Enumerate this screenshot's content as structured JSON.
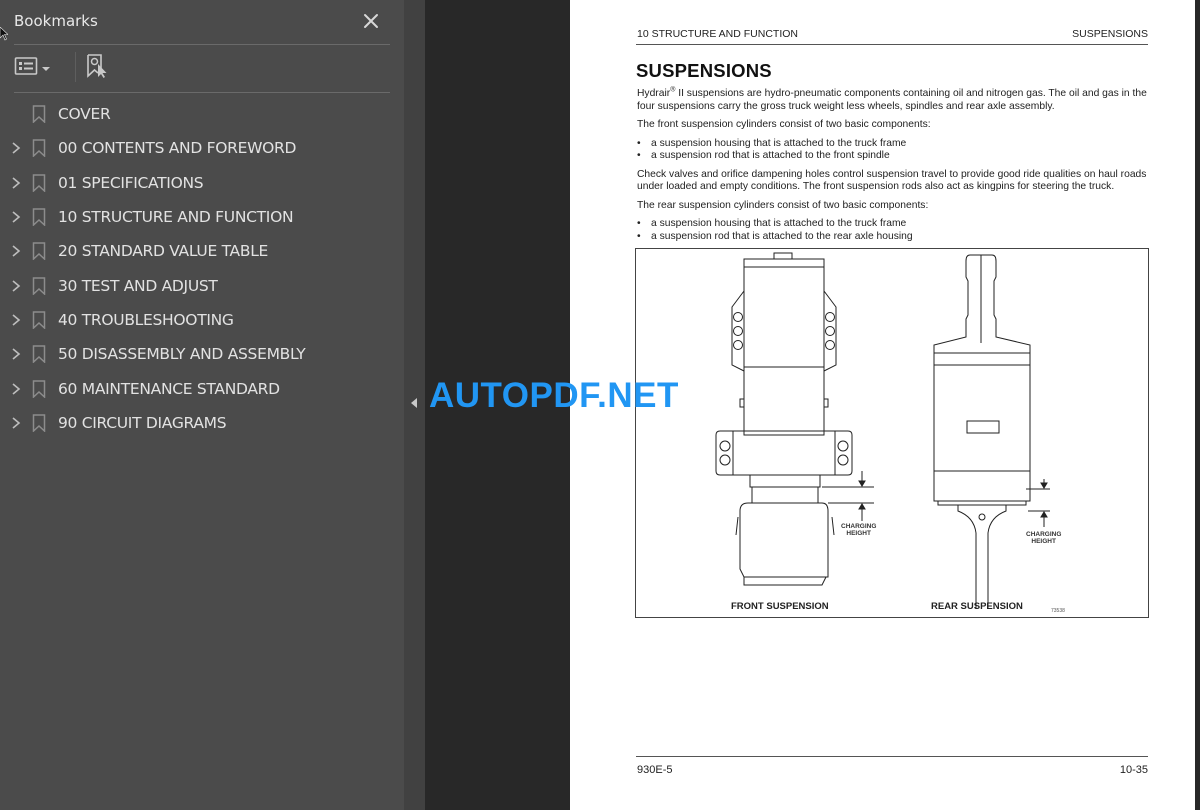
{
  "bookmarks_panel": {
    "title": "Bookmarks",
    "close_icon": "close-icon",
    "toolbar": {
      "options_icon": "list-options-icon",
      "dropdown_icon": "caret-down-icon",
      "find_bookmark_icon": "bookmark-find-icon"
    },
    "items": [
      {
        "label": "COVER",
        "expandable": false
      },
      {
        "label": "00 CONTENTS AND FOREWORD",
        "expandable": true
      },
      {
        "label": "01 SPECIFICATIONS",
        "expandable": true
      },
      {
        "label": "10 STRUCTURE AND FUNCTION",
        "expandable": true
      },
      {
        "label": "20 STANDARD VALUE TABLE",
        "expandable": true
      },
      {
        "label": "30 TEST AND ADJUST",
        "expandable": true
      },
      {
        "label": "40 TROUBLESHOOTING",
        "expandable": true
      },
      {
        "label": "50 DISASSEMBLY AND ASSEMBLY",
        "expandable": true
      },
      {
        "label": "60 MAINTENANCE STANDARD",
        "expandable": true
      },
      {
        "label": "90 CIRCUIT DIAGRAMS",
        "expandable": true
      }
    ]
  },
  "watermark": "AUTOPDF.NET",
  "page": {
    "header_left": "10 STRUCTURE AND FUNCTION",
    "header_right": "SUSPENSIONS",
    "title": "SUSPENSIONS",
    "intro_brand": "Hydrair",
    "intro_reg": "®",
    "intro_rest": " II suspensions are hydro-pneumatic components containing oil and nitrogen gas. The oil and gas in the four suspensions carry the gross truck weight less wheels, spindles and rear axle assembly.",
    "front_intro": "The front suspension cylinders consist of two basic components:",
    "front_bullets": [
      "a suspension housing that is attached to the truck frame",
      "a suspension rod that is attached to the front spindle"
    ],
    "check_valves": "Check valves and orifice dampening holes control suspension travel to provide good ride qualities on haul roads under loaded and empty conditions. The front suspension rods also act as kingpins for steering the truck.",
    "rear_intro": "The rear suspension cylinders consist of two basic components:",
    "rear_bullets": [
      "a suspension housing that is attached to the truck frame",
      "a suspension rod that is attached to the rear axle housing"
    ],
    "figure": {
      "front_caption": "FRONT SUSPENSION",
      "rear_caption": "REAR SUSPENSION",
      "charging_line1": "CHARGING",
      "charging_line2": "HEIGHT",
      "figure_number": "73538"
    },
    "footer_left": "930E-5",
    "footer_right": "10-35"
  },
  "colors": {
    "panel_bg": "#4b4b4b",
    "doc_bg": "#282828",
    "watermark": "#2196f3"
  }
}
